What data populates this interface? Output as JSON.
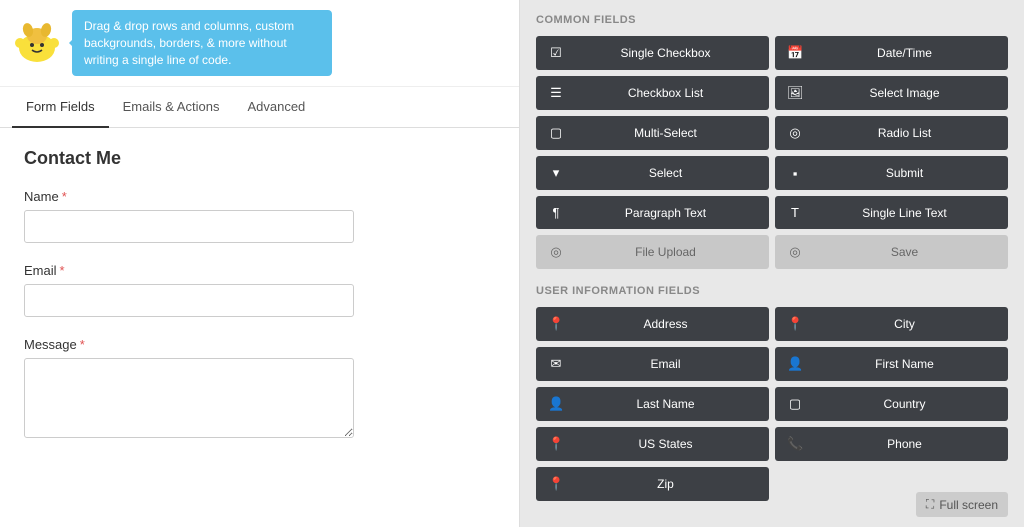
{
  "header": {
    "tooltip": "Drag & drop rows and columns, custom backgrounds, borders, & more without writing a single line of code."
  },
  "tabs": [
    {
      "label": "Form Fields",
      "active": true
    },
    {
      "label": "Emails & Actions",
      "active": false
    },
    {
      "label": "Advanced",
      "active": false
    }
  ],
  "form": {
    "title": "Contact Me",
    "fields": [
      {
        "label": "Name",
        "required": true,
        "type": "text"
      },
      {
        "label": "Email",
        "required": true,
        "type": "text"
      },
      {
        "label": "Message",
        "required": true,
        "type": "textarea"
      }
    ]
  },
  "right_panel": {
    "common_fields_label": "COMMON FIELDS",
    "common_fields": [
      {
        "icon": "☑",
        "label": "Single Checkbox",
        "light": false
      },
      {
        "icon": "📅",
        "label": "Date/Time",
        "light": false
      },
      {
        "icon": "☰",
        "label": "Checkbox List",
        "light": false
      },
      {
        "icon": "🖼",
        "label": "Select Image",
        "light": false
      },
      {
        "icon": "▢",
        "label": "Multi-Select",
        "light": false
      },
      {
        "icon": "◎",
        "label": "Radio List",
        "light": false
      },
      {
        "icon": "▾",
        "label": "Select",
        "light": false
      },
      {
        "icon": "▪",
        "label": "Submit",
        "light": false
      },
      {
        "icon": "¶",
        "label": "Paragraph Text",
        "light": false
      },
      {
        "icon": "T",
        "label": "Single Line Text",
        "light": false
      },
      {
        "icon": "◎",
        "label": "File Upload",
        "light": true
      },
      {
        "icon": "◎",
        "label": "Save",
        "light": true
      }
    ],
    "user_fields_label": "USER INFORMATION FIELDS",
    "user_fields": [
      {
        "icon": "📍",
        "label": "Address",
        "light": false
      },
      {
        "icon": "📍",
        "label": "City",
        "light": false
      },
      {
        "icon": "✉",
        "label": "Email",
        "light": false
      },
      {
        "icon": "👤",
        "label": "First Name",
        "light": false
      },
      {
        "icon": "👤",
        "label": "Last Name",
        "light": false
      },
      {
        "icon": "▢",
        "label": "Country",
        "light": false
      },
      {
        "icon": "📍",
        "label": "US States",
        "light": false
      },
      {
        "icon": "📞",
        "label": "Phone",
        "light": false
      },
      {
        "icon": "📍",
        "label": "Zip",
        "light": false
      }
    ],
    "fullscreen_label": "Full screen"
  }
}
